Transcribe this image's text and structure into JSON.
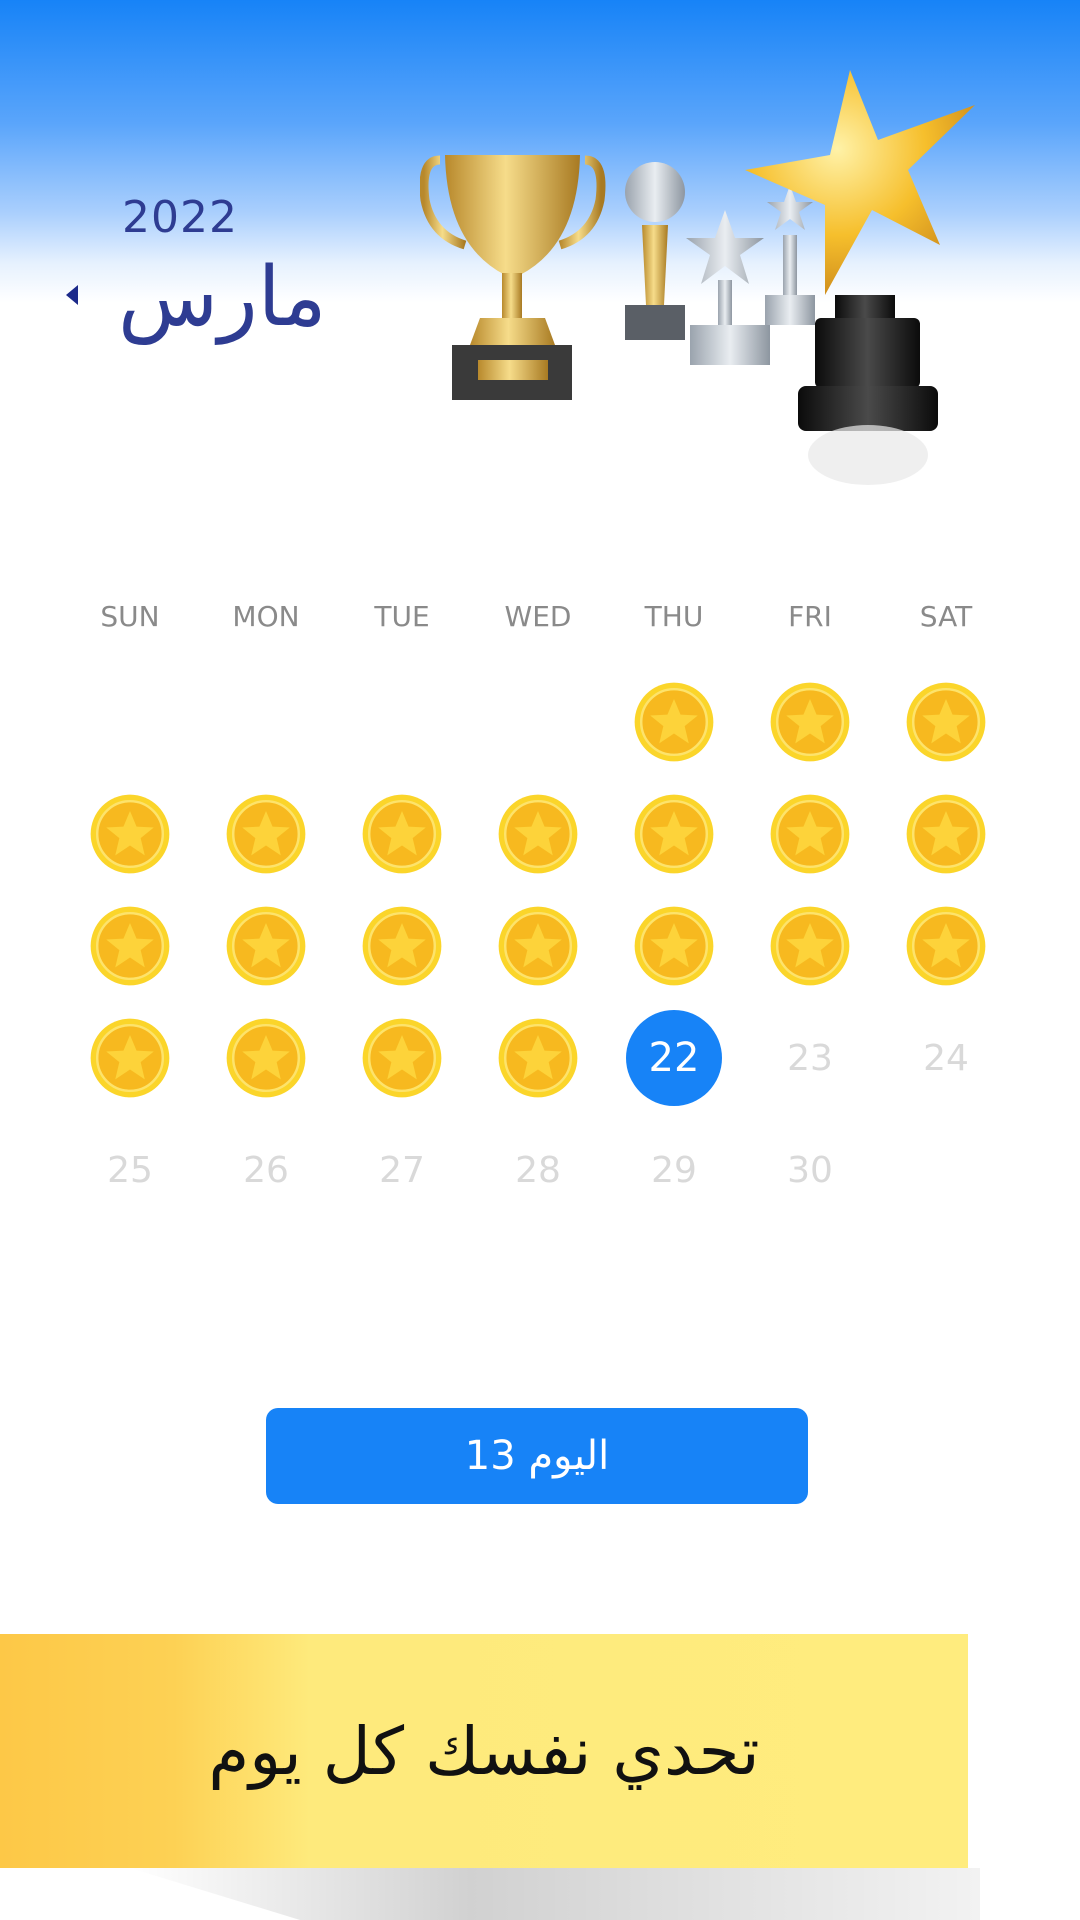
{
  "header": {
    "year": "2022",
    "month": "مارس"
  },
  "weekdays": [
    "SUN",
    "MON",
    "TUE",
    "WED",
    "THU",
    "FRI",
    "SAT"
  ],
  "calendar": {
    "rows": [
      [
        null,
        null,
        null,
        null,
        {
          "type": "coin"
        },
        {
          "type": "coin"
        },
        {
          "type": "coin"
        }
      ],
      [
        {
          "type": "coin"
        },
        {
          "type": "coin"
        },
        {
          "type": "coin"
        },
        {
          "type": "coin"
        },
        {
          "type": "coin"
        },
        {
          "type": "coin"
        },
        {
          "type": "coin"
        }
      ],
      [
        {
          "type": "coin"
        },
        {
          "type": "coin"
        },
        {
          "type": "coin"
        },
        {
          "type": "coin"
        },
        {
          "type": "coin"
        },
        {
          "type": "coin"
        },
        {
          "type": "coin"
        }
      ],
      [
        {
          "type": "coin"
        },
        {
          "type": "coin"
        },
        {
          "type": "coin"
        },
        {
          "type": "coin"
        },
        {
          "type": "today",
          "label": "22"
        },
        {
          "type": "future",
          "label": "23"
        },
        {
          "type": "future",
          "label": "24"
        }
      ],
      [
        {
          "type": "future",
          "label": "25"
        },
        {
          "type": "future",
          "label": "26"
        },
        {
          "type": "future",
          "label": "27"
        },
        {
          "type": "future",
          "label": "28"
        },
        {
          "type": "future",
          "label": "29"
        },
        {
          "type": "future",
          "label": "30"
        },
        null
      ]
    ],
    "coin_icon": "star-coin-icon"
  },
  "day_button": {
    "label": "اليوم 13"
  },
  "banner": {
    "text": "تحدي نفسك كل يوم"
  },
  "colors": {
    "primary": "#1783f7",
    "title": "#2e3c92",
    "coin": "#f9c51c",
    "future_day": "#d9d9d9",
    "banner": "#ffec7e"
  }
}
